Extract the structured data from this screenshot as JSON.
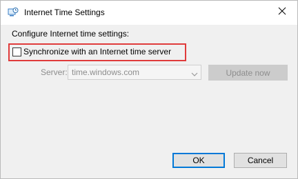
{
  "window": {
    "title": "Internet Time Settings",
    "icons": {
      "app": "internet-time-icon",
      "close": "close-icon"
    }
  },
  "dialog": {
    "configure_label": "Configure Internet time settings:",
    "sync": {
      "label": "Synchronize with an Internet time server",
      "checked": false,
      "highlight_color": "#e03a3a"
    },
    "server": {
      "label": "Server:",
      "value": "time.windows.com",
      "enabled": false
    },
    "update_label": "Update now",
    "ok_label": "OK",
    "cancel_label": "Cancel"
  },
  "colors": {
    "accent": "#0078d7",
    "disabled_text": "#8d8d8d",
    "dialog_background": "#f0f0f0"
  }
}
